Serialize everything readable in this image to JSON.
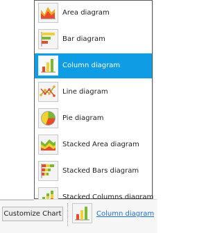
{
  "menu": {
    "items": [
      {
        "label": "Area diagram",
        "icon": "area-chart-icon"
      },
      {
        "label": "Bar diagram",
        "icon": "bar-chart-icon"
      },
      {
        "label": "Column diagram",
        "icon": "column-chart-icon",
        "selected": true
      },
      {
        "label": "Line diagram",
        "icon": "line-chart-icon"
      },
      {
        "label": "Pie diagram",
        "icon": "pie-chart-icon"
      },
      {
        "label": "Stacked Area diagram",
        "icon": "stacked-area-chart-icon"
      },
      {
        "label": "Stacked Bars diagram",
        "icon": "stacked-bars-chart-icon"
      },
      {
        "label": "Stacked Columns diagram",
        "icon": "stacked-columns-chart-icon"
      }
    ]
  },
  "toolbar": {
    "customize_label": "Customize Chart",
    "current_type_label": "Column diagram",
    "current_type_icon": "column-chart-icon"
  },
  "colors": {
    "selection": "#0e9de4",
    "link": "#1a6fd0",
    "red": "#e84a2a",
    "orange": "#f5a623",
    "yellow": "#f2d230",
    "green": "#7cb82f"
  }
}
